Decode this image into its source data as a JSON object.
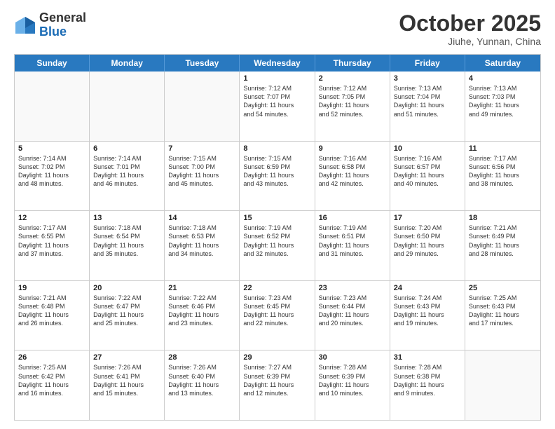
{
  "header": {
    "logo_general": "General",
    "logo_blue": "Blue",
    "title": "October 2025",
    "subtitle": "Jiuhe, Yunnan, China"
  },
  "calendar": {
    "days": [
      "Sunday",
      "Monday",
      "Tuesday",
      "Wednesday",
      "Thursday",
      "Friday",
      "Saturday"
    ],
    "rows": [
      [
        {
          "num": "",
          "empty": true
        },
        {
          "num": "",
          "empty": true
        },
        {
          "num": "",
          "empty": true
        },
        {
          "num": "1",
          "info": "Sunrise: 7:12 AM\nSunset: 7:07 PM\nDaylight: 11 hours\nand 54 minutes."
        },
        {
          "num": "2",
          "info": "Sunrise: 7:12 AM\nSunset: 7:05 PM\nDaylight: 11 hours\nand 52 minutes."
        },
        {
          "num": "3",
          "info": "Sunrise: 7:13 AM\nSunset: 7:04 PM\nDaylight: 11 hours\nand 51 minutes."
        },
        {
          "num": "4",
          "info": "Sunrise: 7:13 AM\nSunset: 7:03 PM\nDaylight: 11 hours\nand 49 minutes."
        }
      ],
      [
        {
          "num": "5",
          "info": "Sunrise: 7:14 AM\nSunset: 7:02 PM\nDaylight: 11 hours\nand 48 minutes."
        },
        {
          "num": "6",
          "info": "Sunrise: 7:14 AM\nSunset: 7:01 PM\nDaylight: 11 hours\nand 46 minutes."
        },
        {
          "num": "7",
          "info": "Sunrise: 7:15 AM\nSunset: 7:00 PM\nDaylight: 11 hours\nand 45 minutes."
        },
        {
          "num": "8",
          "info": "Sunrise: 7:15 AM\nSunset: 6:59 PM\nDaylight: 11 hours\nand 43 minutes."
        },
        {
          "num": "9",
          "info": "Sunrise: 7:16 AM\nSunset: 6:58 PM\nDaylight: 11 hours\nand 42 minutes."
        },
        {
          "num": "10",
          "info": "Sunrise: 7:16 AM\nSunset: 6:57 PM\nDaylight: 11 hours\nand 40 minutes."
        },
        {
          "num": "11",
          "info": "Sunrise: 7:17 AM\nSunset: 6:56 PM\nDaylight: 11 hours\nand 38 minutes."
        }
      ],
      [
        {
          "num": "12",
          "info": "Sunrise: 7:17 AM\nSunset: 6:55 PM\nDaylight: 11 hours\nand 37 minutes."
        },
        {
          "num": "13",
          "info": "Sunrise: 7:18 AM\nSunset: 6:54 PM\nDaylight: 11 hours\nand 35 minutes."
        },
        {
          "num": "14",
          "info": "Sunrise: 7:18 AM\nSunset: 6:53 PM\nDaylight: 11 hours\nand 34 minutes."
        },
        {
          "num": "15",
          "info": "Sunrise: 7:19 AM\nSunset: 6:52 PM\nDaylight: 11 hours\nand 32 minutes."
        },
        {
          "num": "16",
          "info": "Sunrise: 7:19 AM\nSunset: 6:51 PM\nDaylight: 11 hours\nand 31 minutes."
        },
        {
          "num": "17",
          "info": "Sunrise: 7:20 AM\nSunset: 6:50 PM\nDaylight: 11 hours\nand 29 minutes."
        },
        {
          "num": "18",
          "info": "Sunrise: 7:21 AM\nSunset: 6:49 PM\nDaylight: 11 hours\nand 28 minutes."
        }
      ],
      [
        {
          "num": "19",
          "info": "Sunrise: 7:21 AM\nSunset: 6:48 PM\nDaylight: 11 hours\nand 26 minutes."
        },
        {
          "num": "20",
          "info": "Sunrise: 7:22 AM\nSunset: 6:47 PM\nDaylight: 11 hours\nand 25 minutes."
        },
        {
          "num": "21",
          "info": "Sunrise: 7:22 AM\nSunset: 6:46 PM\nDaylight: 11 hours\nand 23 minutes."
        },
        {
          "num": "22",
          "info": "Sunrise: 7:23 AM\nSunset: 6:45 PM\nDaylight: 11 hours\nand 22 minutes."
        },
        {
          "num": "23",
          "info": "Sunrise: 7:23 AM\nSunset: 6:44 PM\nDaylight: 11 hours\nand 20 minutes."
        },
        {
          "num": "24",
          "info": "Sunrise: 7:24 AM\nSunset: 6:43 PM\nDaylight: 11 hours\nand 19 minutes."
        },
        {
          "num": "25",
          "info": "Sunrise: 7:25 AM\nSunset: 6:43 PM\nDaylight: 11 hours\nand 17 minutes."
        }
      ],
      [
        {
          "num": "26",
          "info": "Sunrise: 7:25 AM\nSunset: 6:42 PM\nDaylight: 11 hours\nand 16 minutes."
        },
        {
          "num": "27",
          "info": "Sunrise: 7:26 AM\nSunset: 6:41 PM\nDaylight: 11 hours\nand 15 minutes."
        },
        {
          "num": "28",
          "info": "Sunrise: 7:26 AM\nSunset: 6:40 PM\nDaylight: 11 hours\nand 13 minutes."
        },
        {
          "num": "29",
          "info": "Sunrise: 7:27 AM\nSunset: 6:39 PM\nDaylight: 11 hours\nand 12 minutes."
        },
        {
          "num": "30",
          "info": "Sunrise: 7:28 AM\nSunset: 6:39 PM\nDaylight: 11 hours\nand 10 minutes."
        },
        {
          "num": "31",
          "info": "Sunrise: 7:28 AM\nSunset: 6:38 PM\nDaylight: 11 hours\nand 9 minutes."
        },
        {
          "num": "",
          "empty": true
        }
      ]
    ]
  }
}
